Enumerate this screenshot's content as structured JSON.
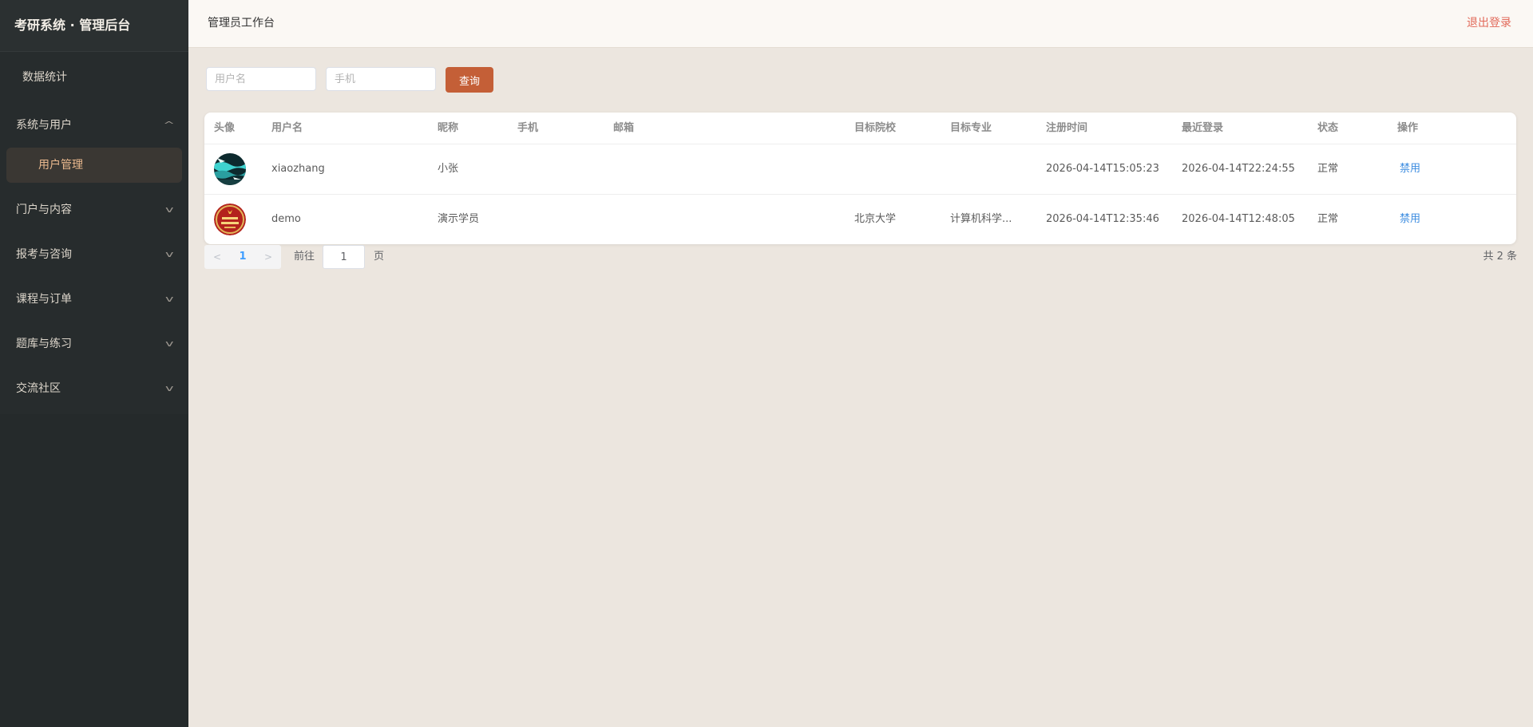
{
  "sidebar": {
    "title": "考研系统 · 管理后台",
    "items": [
      {
        "label": "数据统计"
      },
      {
        "label": "系统与用户",
        "expanded": true,
        "children": [
          {
            "label": "用户管理",
            "active": true
          }
        ]
      },
      {
        "label": "门户与内容"
      },
      {
        "label": "报考与咨询"
      },
      {
        "label": "课程与订单"
      },
      {
        "label": "题库与练习"
      },
      {
        "label": "交流社区"
      }
    ]
  },
  "header": {
    "title": "管理员工作台",
    "logout_label": "退出登录"
  },
  "filters": {
    "username_placeholder": "用户名",
    "phone_placeholder": "手机",
    "query_label": "查询"
  },
  "table": {
    "columns": [
      "头像",
      "用户名",
      "昵称",
      "手机",
      "邮箱",
      "目标院校",
      "目标专业",
      "注册时间",
      "最近登录",
      "状态",
      "操作"
    ],
    "rows": [
      {
        "avatar_icon": "avatar-image-teal",
        "username": "xiaozhang",
        "nickname": "小张",
        "phone": "",
        "email": "",
        "target_school": "",
        "target_major": "",
        "registered": "2026-04-14T15:05:23",
        "last_login": "2026-04-14T22:24:55",
        "status": "正常",
        "action": "禁用"
      },
      {
        "avatar_icon": "avatar-image-red",
        "username": "demo",
        "nickname": "演示学员",
        "phone": "",
        "email": "",
        "target_school": "北京大学",
        "target_major": "计算机科学...",
        "registered": "2026-04-14T12:35:46",
        "last_login": "2026-04-14T12:48:05",
        "status": "正常",
        "action": "禁用"
      }
    ]
  },
  "pagination": {
    "prev_icon": "chevron-left-icon",
    "next_icon": "chevron-right-icon",
    "current_page": "1",
    "goto_prefix": "前往",
    "goto_value": "1",
    "goto_suffix": "页",
    "total_text": "共 2 条"
  },
  "colors": {
    "sidebar_bg": "#252a2b",
    "active_menu_text": "#eab98e",
    "primary_button": "#c45f37",
    "logout": "#e26a5a",
    "link": "#3c8ce0",
    "page_bg": "#ece6df"
  }
}
